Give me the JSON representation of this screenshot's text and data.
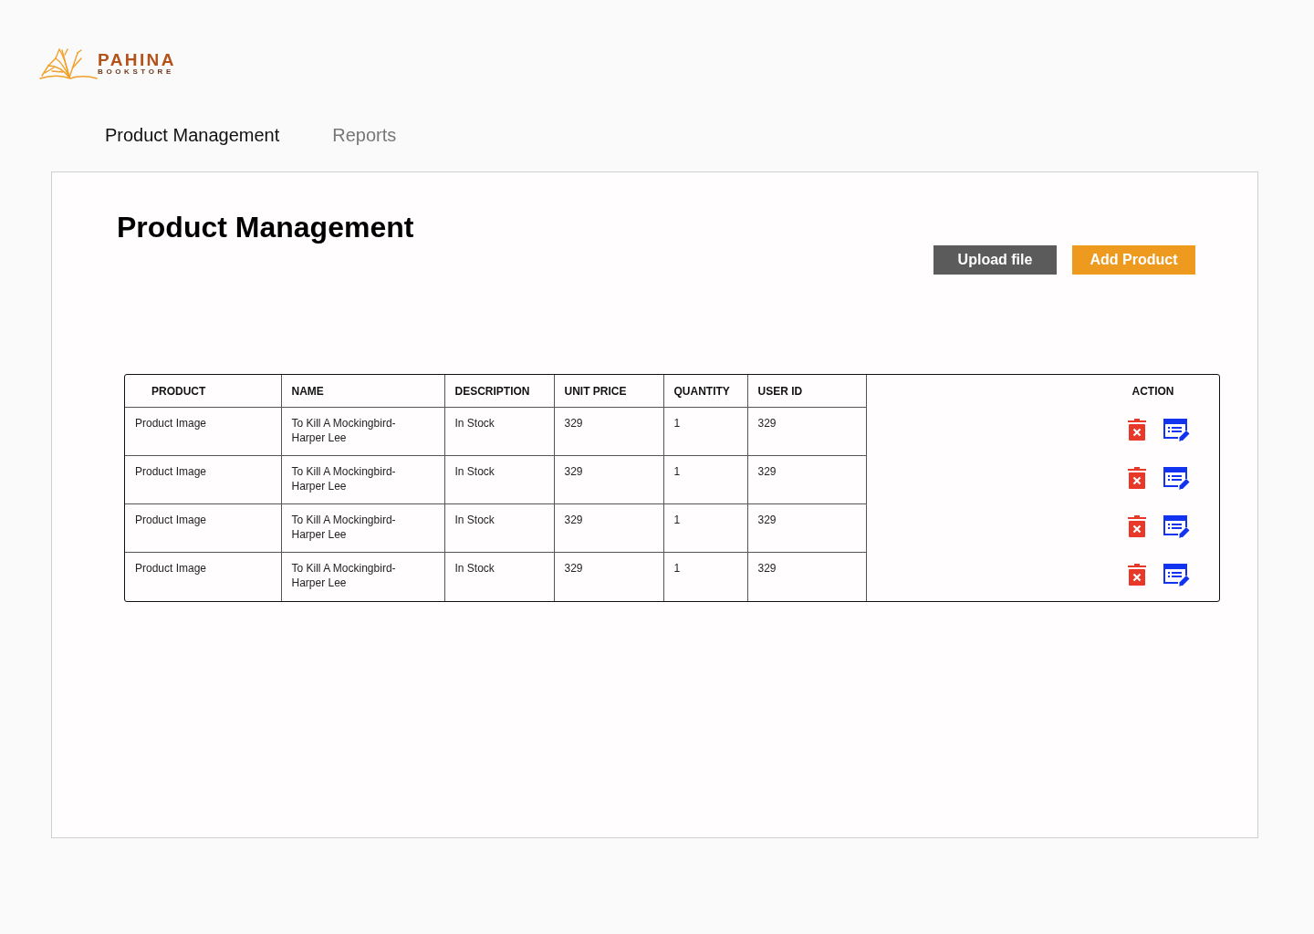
{
  "logo": {
    "name": "PAHINA",
    "tagline": "BOOKSTORE"
  },
  "nav": [
    {
      "label": "Product Management",
      "selected": true
    },
    {
      "label": "Reports",
      "selected": false
    }
  ],
  "panel": {
    "title": "Product Management",
    "buttons": [
      {
        "label": "Upload file",
        "kind": "secondary"
      },
      {
        "label": "Add Product",
        "kind": "primary"
      }
    ],
    "table": {
      "columns": [
        "PRODUCT",
        "NAME",
        "DESCRIPTION",
        "UNIT PRICE",
        "QUANTITY",
        "USER ID",
        "ACTION"
      ],
      "rows": [
        {
          "cells": [
            "Product Image",
            "To Kill A Mockingbird-Harper Lee",
            "In Stock",
            "329",
            "1",
            "329"
          ]
        },
        {
          "cells": [
            "Product Image",
            "To Kill A Mockingbird-Harper Lee",
            "In Stock",
            "329",
            "1",
            "329"
          ]
        },
        {
          "cells": [
            "Product Image",
            "To Kill A Mockingbird-Harper Lee",
            "In Stock",
            "329",
            "1",
            "329"
          ]
        },
        {
          "cells": [
            "Product Image",
            "To Kill A Mockingbird-Harper Lee",
            "In Stock",
            "329",
            "1",
            "329"
          ]
        }
      ]
    }
  }
}
